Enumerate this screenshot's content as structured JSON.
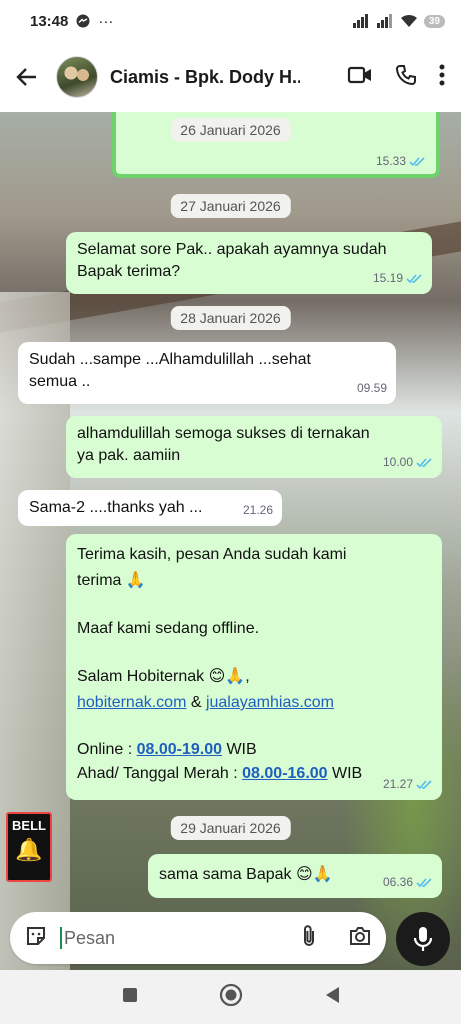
{
  "status": {
    "time": "13:48",
    "battery": "39"
  },
  "header": {
    "title": "Ciamis - Bpk. Dody H..."
  },
  "messages": {
    "prev_time": "15.33",
    "date1": "26 Januari 2026",
    "date2": "27 Januari 2026",
    "m1": {
      "text1": "Selamat sore Pak.. apakah ayamnya sudah",
      "text2": "Bapak terima?",
      "time": "15.19"
    },
    "date3": "28 Januari 2026",
    "m2": {
      "text1": "Sudah ...sampe ...Alhamdulillah ...sehat",
      "text2": "semua ..",
      "time": "09.59"
    },
    "m3": {
      "text1": "alhamdulillah semoga sukses di ternakan",
      "text2": "ya pak. aamiin",
      "time": "10.00"
    },
    "m4": {
      "text": "Sama-2 ....thanks yah ...",
      "time": "21.26"
    },
    "m5": {
      "line1": "Terima kasih, pesan Anda sudah kami",
      "line2": "terima 🙏",
      "line3": "Maaf kami sedang offline.",
      "line4": "Salam Hobiternak 😊🙏,",
      "link1": "hobiternak.com",
      "amp": " & ",
      "link2": "jualayamhias.com",
      "online_label": "Online : ",
      "online_hours": "08.00-19.00",
      "wib1": " WIB",
      "ahad_label": "Ahad/ Tanggal Merah : ",
      "ahad_hours": "08.00-16.00",
      "wib2": " WIB",
      "time": "21.27"
    },
    "date4": "29 Januari 2026",
    "m6": {
      "text": "sama sama Bapak 😊🙏",
      "time": "06.36"
    }
  },
  "input": {
    "placeholder": "Pesan"
  },
  "background_sign": "BELL",
  "colors": {
    "outgoing": "#d9fdd3",
    "incoming": "#ffffff",
    "read_tick": "#53bdeb",
    "link": "#1f5fbf"
  }
}
